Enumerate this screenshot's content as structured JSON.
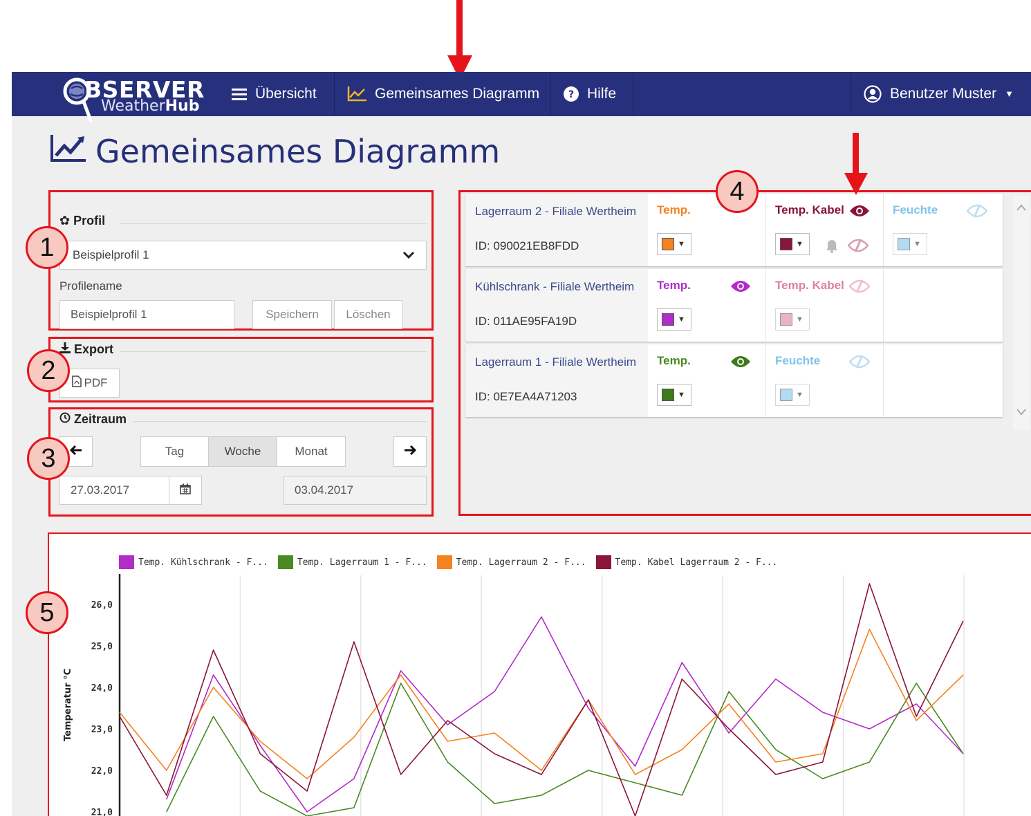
{
  "nav": {
    "logo_main": "BSERVER",
    "logo_sub_a": "Weather",
    "logo_sub_b": "Hub",
    "items": [
      {
        "label": "Übersicht",
        "icon": "menu-icon"
      },
      {
        "label": "Gemeinsames Diagramm",
        "icon": "line-chart-icon"
      },
      {
        "label": "Hilfe",
        "icon": "help-icon"
      }
    ],
    "user": "Benutzer Muster"
  },
  "page_title": "Gemeinsames Diagramm",
  "annotations": [
    "1",
    "2",
    "3",
    "4",
    "5"
  ],
  "profil": {
    "title": "Profil",
    "selected": "Beispielprofil 1",
    "name_label": "Profilename",
    "name_value": "Beispielprofil 1",
    "save": "Speichern",
    "delete": "Löschen"
  },
  "export": {
    "title": "Export",
    "pdf": "PDF"
  },
  "zeitraum": {
    "title": "Zeitraum",
    "tabs": [
      "Tag",
      "Woche",
      "Monat"
    ],
    "active_tab": "Woche",
    "from": "27.03.2017",
    "to": "03.04.2017"
  },
  "sensors": [
    {
      "name": "Lagerraum 2 - Filiale Wertheim",
      "id": "ID: 090021EB8FDD",
      "measurements": [
        {
          "label": "Temp.",
          "color": "#f58220",
          "swatch": "#f58220",
          "visible": true,
          "eye": false
        },
        {
          "label": "Temp. Kabel",
          "color": "#8a1538",
          "swatch": "#8a1538",
          "visible": true,
          "eye": true
        },
        {
          "label": "Feuchte",
          "color": "#7fc4ea",
          "swatch": "#7fc4ea",
          "visible": false,
          "eye": true
        }
      ]
    },
    {
      "name": "Kühlschrank - Filiale Wertheim",
      "id": "ID: 011AE95FA19D",
      "measurements": [
        {
          "label": "Temp.",
          "color": "#b12cc9",
          "swatch": "#b12cc9",
          "visible": true,
          "eye": true
        },
        {
          "label": "Temp. Kabel",
          "color": "#e07fa0",
          "swatch": "#e07fa0",
          "visible": false,
          "eye": true
        }
      ]
    },
    {
      "name": "Lagerraum 1 - Filiale Wertheim",
      "id": "ID: 0E7EA4A71203",
      "measurements": [
        {
          "label": "Temp.",
          "color": "#4a8a22",
          "swatch": "#3d7a1a",
          "visible": true,
          "eye": true
        },
        {
          "label": "Feuchte",
          "color": "#7fc4ea",
          "swatch": "#7fc4ea",
          "visible": false,
          "eye": true
        }
      ]
    }
  ],
  "chart_data": {
    "type": "line",
    "ylabel": "Temperatur °C",
    "yticks": [
      "21,0",
      "22,0",
      "23,0",
      "24,0",
      "25,0",
      "26,0"
    ],
    "ylim": [
      20.9,
      26.7
    ],
    "x": [
      0,
      0.5,
      1,
      1.5,
      2,
      2.5,
      3,
      3.5,
      4,
      4.5,
      5,
      5.5,
      6,
      6.5,
      7
    ],
    "series": [
      {
        "name": "Temp. Kühlschrank - F...",
        "color": "#b12cc9",
        "values": [
          null,
          21.3,
          24.3,
          22.6,
          21.0,
          21.8,
          24.4,
          23.1,
          23.9,
          25.7,
          23.5,
          22.1,
          24.6,
          22.9,
          24.2,
          23.4,
          23.0,
          23.6,
          22.4
        ]
      },
      {
        "name": "Temp. Lagerraum 1 - F...",
        "color": "#4a8a22",
        "values": [
          null,
          21.0,
          23.3,
          21.5,
          20.9,
          21.1,
          24.1,
          22.2,
          21.2,
          21.4,
          22.0,
          21.7,
          21.4,
          23.9,
          22.5,
          21.8,
          22.2,
          24.1,
          22.4
        ]
      },
      {
        "name": "Temp. Lagerraum 2 - F...",
        "color": "#f58220",
        "values": [
          23.4,
          22.0,
          24.0,
          22.7,
          21.8,
          22.8,
          24.3,
          22.7,
          22.9,
          22.0,
          23.7,
          21.9,
          22.5,
          23.6,
          22.2,
          22.4,
          25.4,
          23.2,
          24.3
        ]
      },
      {
        "name": "Temp. Kabel Lagerraum 2 - F...",
        "color": "#8a1538",
        "values": [
          23.3,
          21.4,
          24.9,
          22.4,
          21.5,
          25.1,
          21.9,
          23.2,
          22.4,
          21.9,
          23.7,
          20.9,
          24.2,
          23.0,
          21.9,
          22.2,
          26.5,
          23.3,
          25.6
        ]
      }
    ]
  }
}
